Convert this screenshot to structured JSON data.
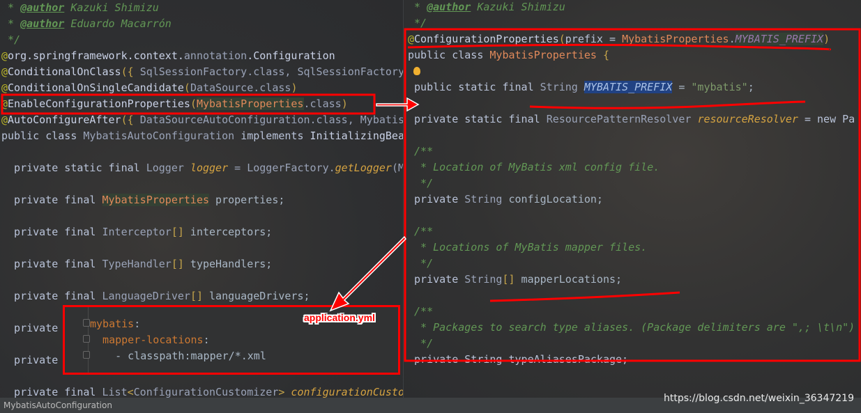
{
  "left_editor": {
    "lines": [
      {
        "y": 0,
        "tokens": [
          {
            "t": " * ",
            "k": "c"
          },
          {
            "t": "@author",
            "k": "tag"
          },
          {
            "t": " Kazuki Shimizu",
            "k": "c"
          }
        ]
      },
      {
        "y": 1,
        "tokens": [
          {
            "t": " * ",
            "k": "c"
          },
          {
            "t": "@author",
            "k": "tag"
          },
          {
            "t": " Eduardo Macarrón",
            "k": "c"
          }
        ]
      },
      {
        "y": 2,
        "tokens": [
          {
            "t": " */",
            "k": "c"
          }
        ]
      },
      {
        "y": 3,
        "tokens": [
          {
            "t": "@",
            "k": "at"
          },
          {
            "t": "org.springframework.context.",
            "k": "ann"
          },
          {
            "t": "annotation",
            "k": "ty"
          },
          {
            "t": ".Configuration",
            "k": "ann"
          }
        ]
      },
      {
        "y": 4,
        "tokens": [
          {
            "t": "@",
            "k": "at"
          },
          {
            "t": "ConditionalOnClass",
            "k": "ann"
          },
          {
            "t": "({ ",
            "k": "br"
          },
          {
            "t": "SqlSessionFactory.class, SqlSessionFactory",
            "k": "ty"
          }
        ]
      },
      {
        "y": 5,
        "tokens": [
          {
            "t": "@",
            "k": "at"
          },
          {
            "t": "ConditionalOnSingleCandidate",
            "k": "ann"
          },
          {
            "t": "(",
            "k": "br"
          },
          {
            "t": "DataSource.class",
            "k": "ty"
          },
          {
            "t": ")",
            "k": "br"
          }
        ]
      },
      {
        "y": 6,
        "tokens": [
          {
            "t": "@",
            "k": "at"
          },
          {
            "t": "EnableConfigurationProperties",
            "k": "ann"
          },
          {
            "t": "(",
            "k": "br"
          },
          {
            "t": "MybatisProperties",
            "k": "or hl"
          },
          {
            "t": ".class",
            "k": "ty"
          },
          {
            "t": ")",
            "k": "br"
          }
        ]
      },
      {
        "y": 7,
        "tokens": [
          {
            "t": "@",
            "k": "at"
          },
          {
            "t": "AutoConfigureAfter",
            "k": "ann"
          },
          {
            "t": "({ ",
            "k": "br"
          },
          {
            "t": "DataSourceAutoConfiguration.class, Mybatis",
            "k": "ty"
          }
        ]
      },
      {
        "y": 8,
        "tokens": [
          {
            "t": "public class ",
            "k": "kw"
          },
          {
            "t": "MybatisAutoConfiguration ",
            "k": "ty"
          },
          {
            "t": "implements ",
            "k": "kw"
          },
          {
            "t": "InitializingBea",
            "k": "ann"
          }
        ]
      },
      {
        "y": 10,
        "tokens": [
          {
            "t": "  private static final ",
            "k": "kw"
          },
          {
            "t": "Logger ",
            "k": "ty"
          },
          {
            "t": "logger",
            "k": "fi"
          },
          {
            "t": " = LoggerFactory.",
            "k": "ty"
          },
          {
            "t": "getLogger",
            "k": "fi"
          },
          {
            "t": "(M",
            "k": "ty"
          }
        ]
      },
      {
        "y": 12,
        "tokens": [
          {
            "t": "  private final ",
            "k": "kw"
          },
          {
            "t": "MybatisProperties",
            "k": "or hl"
          },
          {
            "t": " properties;",
            "k": ""
          }
        ]
      },
      {
        "y": 14,
        "tokens": [
          {
            "t": "  private final ",
            "k": "kw"
          },
          {
            "t": "Interceptor",
            "k": "ty"
          },
          {
            "t": "[]",
            "k": "br"
          },
          {
            "t": " interceptors;",
            "k": ""
          }
        ]
      },
      {
        "y": 16,
        "tokens": [
          {
            "t": "  private final ",
            "k": "kw"
          },
          {
            "t": "TypeHandler",
            "k": "ty"
          },
          {
            "t": "[]",
            "k": "br"
          },
          {
            "t": " typeHandlers;",
            "k": ""
          }
        ]
      },
      {
        "y": 18,
        "tokens": [
          {
            "t": "  private final ",
            "k": "kw"
          },
          {
            "t": "LanguageDriver",
            "k": "ty"
          },
          {
            "t": "[]",
            "k": "br"
          },
          {
            "t": " languageDrivers;",
            "k": ""
          }
        ]
      },
      {
        "y": 20,
        "tokens": [
          {
            "t": "  private",
            "k": "kw"
          }
        ]
      },
      {
        "y": 22,
        "tokens": [
          {
            "t": "  private",
            "k": "kw"
          }
        ]
      },
      {
        "y": 24,
        "tokens": [
          {
            "t": "  private final ",
            "k": "kw"
          },
          {
            "t": "List",
            "k": "ty"
          },
          {
            "t": "<",
            "k": "br"
          },
          {
            "t": "ConfigurationCustomizer",
            "k": "ty"
          },
          {
            "t": ">",
            "k": "br"
          },
          {
            "t": " configurationCustomizers;",
            "k": "fi"
          }
        ]
      }
    ]
  },
  "right_editor": {
    "lines": [
      {
        "y": 0,
        "tokens": [
          {
            "t": " * ",
            "k": "c"
          },
          {
            "t": "@author",
            "k": "tag"
          },
          {
            "t": " Kazuki Shimizu",
            "k": "c"
          }
        ]
      },
      {
        "y": 1,
        "tokens": [
          {
            "t": " */",
            "k": "c"
          }
        ]
      },
      {
        "y": 2,
        "tokens": [
          {
            "t": "@",
            "k": "at"
          },
          {
            "t": "ConfigurationProperties",
            "k": "ann"
          },
          {
            "t": "(",
            "k": "br"
          },
          {
            "t": "prefix = ",
            "k": "kw"
          },
          {
            "t": "MybatisProperties",
            "k": "or"
          },
          {
            "t": ".",
            "k": ""
          },
          {
            "t": "MYBATIS_PREFIX",
            "k": "cst hl"
          },
          {
            "t": ")",
            "k": "br"
          }
        ]
      },
      {
        "y": 3,
        "tokens": [
          {
            "t": "public class ",
            "k": "kw"
          },
          {
            "t": "MybatisProperties ",
            "k": "or"
          },
          {
            "t": "{",
            "k": "br"
          }
        ]
      },
      {
        "y": 5,
        "tokens": [
          {
            "t": " public static final ",
            "k": "kw"
          },
          {
            "t": "String ",
            "k": "ty"
          },
          {
            "t": "MYBATIS_PREFIX",
            "k": "sel"
          },
          {
            "t": " = ",
            "k": ""
          },
          {
            "t": "\"mybatis\"",
            "k": "str"
          },
          {
            "t": ";",
            "k": ""
          }
        ]
      },
      {
        "y": 7,
        "tokens": [
          {
            "t": " private static final ",
            "k": "kw"
          },
          {
            "t": "ResourcePatternResolver ",
            "k": "ty"
          },
          {
            "t": "resourceResolver",
            "k": "fi"
          },
          {
            "t": " = new Pa",
            "k": "kw"
          }
        ]
      },
      {
        "y": 9,
        "tokens": [
          {
            "t": " /**",
            "k": "c"
          }
        ]
      },
      {
        "y": 10,
        "tokens": [
          {
            "t": "  * Location of MyBatis xml config file.",
            "k": "c"
          }
        ]
      },
      {
        "y": 11,
        "tokens": [
          {
            "t": "  */",
            "k": "c"
          }
        ]
      },
      {
        "y": 12,
        "tokens": [
          {
            "t": " private ",
            "k": "kw"
          },
          {
            "t": "String ",
            "k": "ty"
          },
          {
            "t": "configLocation;",
            "k": ""
          }
        ]
      },
      {
        "y": 14,
        "tokens": [
          {
            "t": " /**",
            "k": "c"
          }
        ]
      },
      {
        "y": 15,
        "tokens": [
          {
            "t": "  * Locations of MyBatis mapper files.",
            "k": "c"
          }
        ]
      },
      {
        "y": 16,
        "tokens": [
          {
            "t": "  */",
            "k": "c"
          }
        ]
      },
      {
        "y": 17,
        "tokens": [
          {
            "t": " private ",
            "k": "kw"
          },
          {
            "t": "String",
            "k": "ty"
          },
          {
            "t": "[]",
            "k": "br"
          },
          {
            "t": " mapperLocations;",
            "k": ""
          }
        ]
      },
      {
        "y": 19,
        "tokens": [
          {
            "t": " /**",
            "k": "c"
          }
        ]
      },
      {
        "y": 20,
        "tokens": [
          {
            "t": "  * Packages to search type aliases. (Package delimiters are \",; \\t\\n\")",
            "k": "c"
          }
        ]
      },
      {
        "y": 21,
        "tokens": [
          {
            "t": "  */",
            "k": "c"
          }
        ]
      },
      {
        "y": 22,
        "tokens": [
          {
            "t": " private String typeAliasesPackage;",
            "k": "kw"
          }
        ]
      }
    ]
  },
  "yml_popup": {
    "label": "application.yml",
    "lines": [
      {
        "y": 0,
        "tokens": [
          {
            "t": "mybatis",
            "k": "yk"
          },
          {
            "t": ":",
            "k": "yv"
          }
        ]
      },
      {
        "y": 1,
        "tokens": [
          {
            "t": "  mapper-locations",
            "k": "yk"
          },
          {
            "t": ":",
            "k": "yv"
          }
        ]
      },
      {
        "y": 2,
        "tokens": [
          {
            "t": "    - classpath:mapper/*.xml",
            "k": "yv"
          }
        ]
      }
    ]
  },
  "status_bar": {
    "breadcrumb": "MybatisAutoConfiguration"
  },
  "watermark": "https://blog.csdn.net/weixin_36347219",
  "colors": {
    "annotation_red": "#ff0000",
    "background": "#2d2e30"
  }
}
